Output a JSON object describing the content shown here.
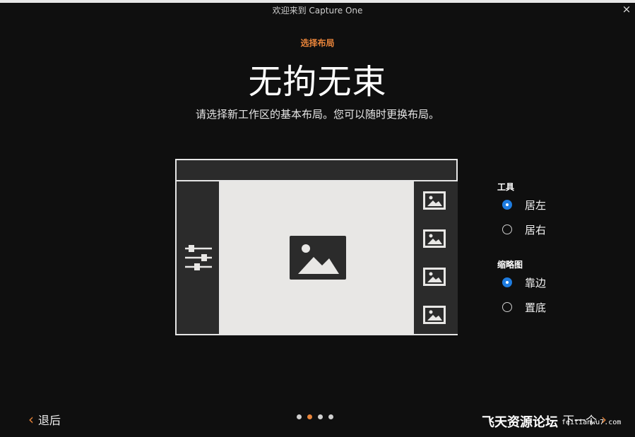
{
  "window": {
    "title": "欢迎来到 Capture One",
    "close_glyph": "×"
  },
  "header": {
    "step": "选择布局",
    "title": "无拘无束",
    "subtitle": "请选择新工作区的基本布局。您可以随时更换布局。"
  },
  "options": {
    "tools": {
      "title": "工具",
      "items": [
        {
          "label": "居左",
          "selected": true
        },
        {
          "label": "居右",
          "selected": false
        }
      ]
    },
    "thumbnails": {
      "title": "缩略图",
      "items": [
        {
          "label": "靠边",
          "selected": true
        },
        {
          "label": "置底",
          "selected": false
        }
      ]
    }
  },
  "footer": {
    "back_label": "退后",
    "next_label": "下一个",
    "pager": {
      "total": 4,
      "current": 2
    }
  },
  "watermark": {
    "text": "飞天资源论坛",
    "url": "feitianwu7.com"
  },
  "colors": {
    "accent": "#e8843a",
    "radio_on": "#1e7ce0",
    "background": "#0f0f0f"
  }
}
